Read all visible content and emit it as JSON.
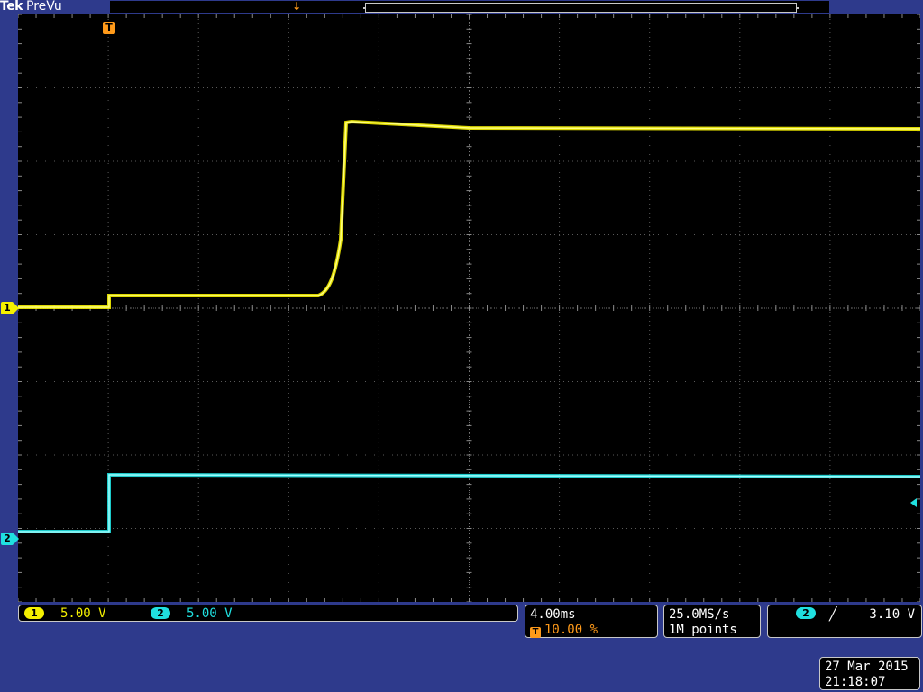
{
  "header": {
    "brand": "Tek",
    "mode": "PreVu"
  },
  "trigger": {
    "marker_label": "T",
    "position_percent": 10.0
  },
  "channels": [
    {
      "id": "1",
      "scale": "5.00 V",
      "color": "#f5f000"
    },
    {
      "id": "2",
      "scale": "5.00 V",
      "color": "#20e0e0"
    }
  ],
  "horizontal": {
    "time_per_div": "4.00ms",
    "trigger_position": "10.00 %"
  },
  "acquisition": {
    "sample_rate": "25.0MS/s",
    "record_length": "1M points"
  },
  "trigger_info": {
    "source": "2",
    "slope": "rising-edge-icon",
    "slope_glyph": "╱",
    "level": "3.10 V"
  },
  "datetime": {
    "date": "27 Mar 2015",
    "time": "21:18:07"
  },
  "colors": {
    "background": "#2e3a8c",
    "screen": "#000000",
    "trigger": "#ff9a1a",
    "ch1": "#f5f000",
    "ch2": "#20e0e0"
  }
}
